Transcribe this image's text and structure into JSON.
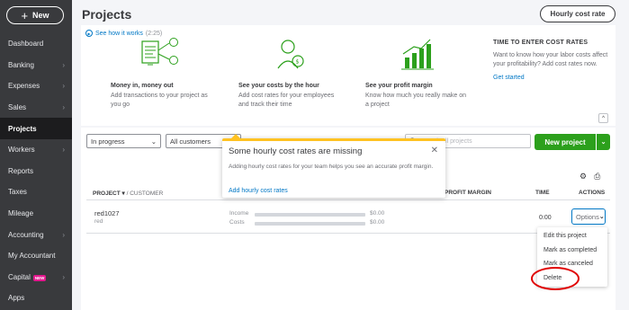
{
  "sidebar": {
    "new_button": "New",
    "items": [
      {
        "label": "Dashboard",
        "chevron": false
      },
      {
        "label": "Banking",
        "chevron": true
      },
      {
        "label": "Expenses",
        "chevron": true
      },
      {
        "label": "Sales",
        "chevron": true
      },
      {
        "label": "Projects",
        "chevron": false,
        "active": true
      },
      {
        "label": "Workers",
        "chevron": true
      },
      {
        "label": "Reports",
        "chevron": false
      },
      {
        "label": "Taxes",
        "chevron": false
      },
      {
        "label": "Mileage",
        "chevron": false
      },
      {
        "label": "Accounting",
        "chevron": true
      },
      {
        "label": "My Accountant",
        "chevron": false
      },
      {
        "label": "Capital",
        "chevron": true,
        "badge": "NEW"
      },
      {
        "label": "Apps",
        "chevron": false
      }
    ]
  },
  "header": {
    "title": "Projects",
    "hourly_cost_rate_button": "Hourly cost rate"
  },
  "promo": {
    "see_how": "See how it works",
    "duration": "(2:25)",
    "cols": [
      {
        "icon": "invoice-icon",
        "heading": "Money in, money out",
        "desc": "Add transactions to your project as you go"
      },
      {
        "icon": "person-money-icon",
        "heading": "See your costs by the hour",
        "desc": "Add cost rates for your employees and track their time"
      },
      {
        "icon": "bar-chart-icon",
        "heading": "See your profit margin",
        "desc": "Know how much you really make on a project"
      }
    ],
    "time_box": {
      "heading": "TIME TO ENTER COST RATES",
      "desc": "Want to know how your labor costs affect your profitability? Add cost rates now.",
      "link": "Get started"
    }
  },
  "filters": {
    "status": "In progress",
    "customer": "All customers",
    "search_placeholder": "Search all projects",
    "new_project": "New project"
  },
  "table": {
    "headers": {
      "project": "PROJECT",
      "customer": "/ CUSTOMER",
      "profit_margin": "PROFIT MARGIN",
      "time": "TIME",
      "actions": "ACTIONS"
    },
    "rows": [
      {
        "name": "red1027",
        "customer": "red",
        "income_label": "Income",
        "income_value": "$0.00",
        "costs_label": "Costs",
        "costs_value": "$0.00",
        "time": "0:00",
        "options_label": "Options"
      }
    ]
  },
  "options_menu": {
    "items": [
      "Edit this project",
      "Mark as completed",
      "Mark as canceled",
      "Delete"
    ]
  },
  "popover": {
    "title": "Some hourly cost rates are missing",
    "desc": "Adding hourly cost rates for your team helps you see an accurate profit margin.",
    "link": "Add hourly cost rates"
  },
  "colors": {
    "sidebar_bg": "#393a3d",
    "primary_green": "#2ca01c",
    "link_blue": "#0077c5",
    "popover_accent": "#ffc222",
    "highlight_red": "#e00000"
  }
}
